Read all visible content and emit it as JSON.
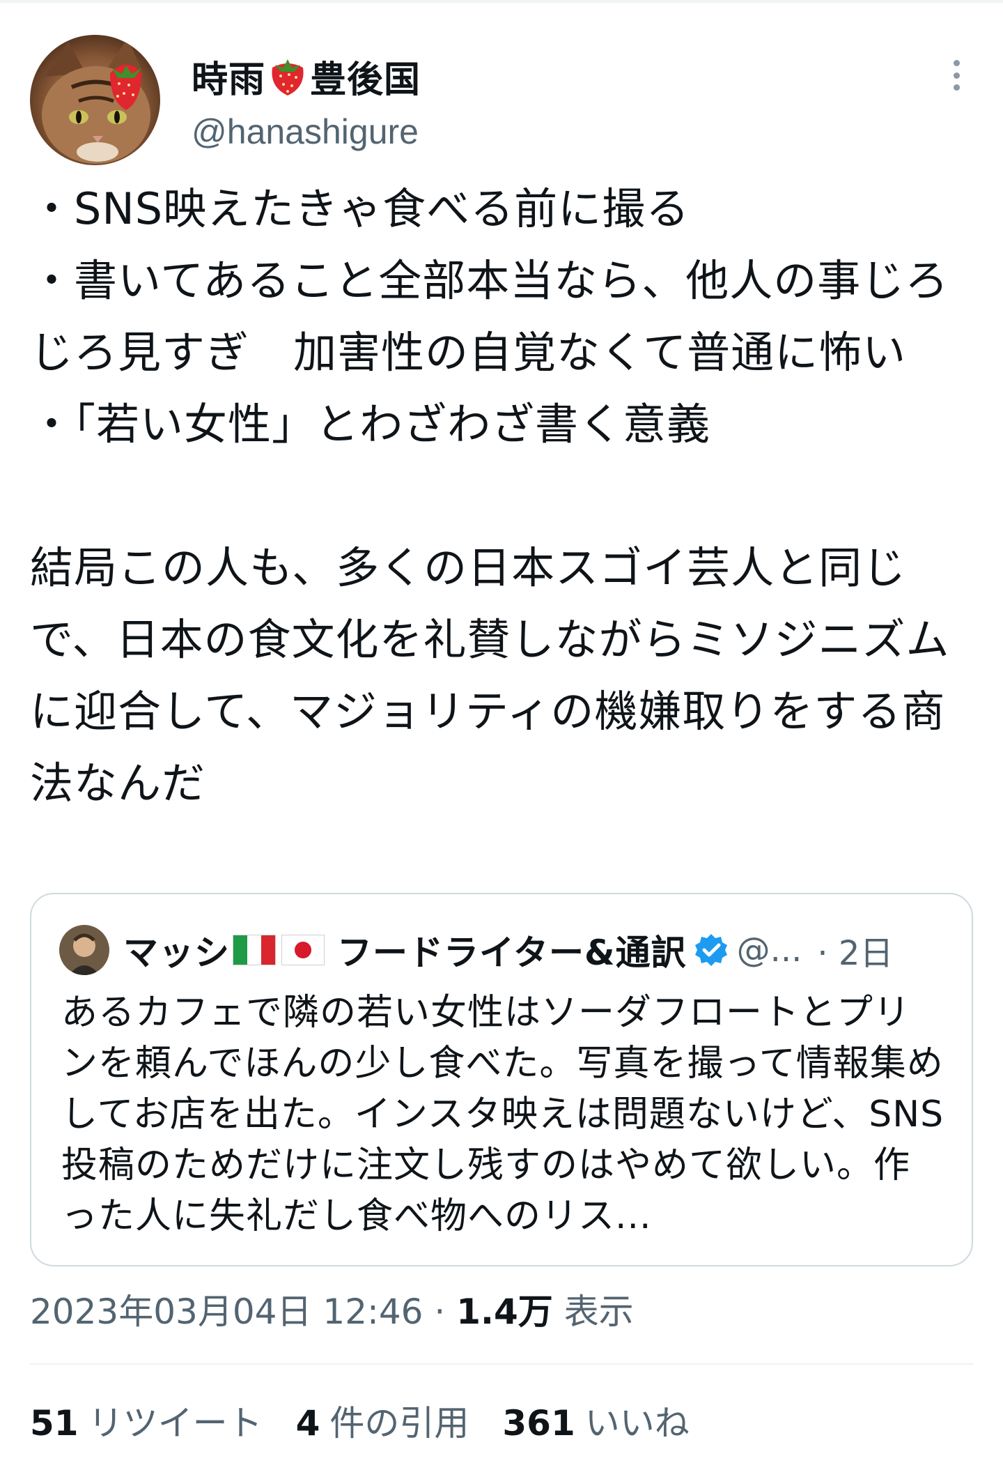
{
  "author": {
    "name_prefix": "時雨",
    "name_emoji": "strawberry-icon",
    "name_suffix": "豊後国",
    "handle": "@hanashigure"
  },
  "tweet": {
    "text": "・SNS映えたきゃ食べる前に撮る\n・書いてあること全部本当なら、他人の事じろじろ見すぎ　加害性の自覚なくて普通に怖い\n・「若い女性」とわざわざ書く意義\n\n結局この人も、多くの日本スゴイ芸人と同じで、日本の食文化を礼賛しながらミソジニズムに迎合して、マジョリティの機嫌取りをする商法なんだ"
  },
  "quote": {
    "name_prefix": "マッシ",
    "flags": [
      "italy-flag-icon",
      "japan-flag-icon"
    ],
    "name_suffix": "フードライター&通訳",
    "handle": "@...",
    "time": "· 2日",
    "text": "あるカフェで隣の若い女性はソーダフロートとプリンを頼んでほんの少し食べた。写真を撮って情報集めしてお店を出た。インスタ映えは問題ないけど、SNS投稿のためだけに注文し残すのはやめて欲しい。作った人に失礼だし食べ物へのリス..."
  },
  "meta": {
    "timestamp": "2023年03月04日 12:46",
    "separator": "·",
    "views_count": "1.4万",
    "views_label": "表示"
  },
  "stats": {
    "retweets_count": "51",
    "retweets_label": "リツイート",
    "quotes_count": "4",
    "quotes_label": "件の引用",
    "likes_count": "361",
    "likes_label": "いいね"
  },
  "colors": {
    "text": "#0f1419",
    "secondary": "#536471",
    "border": "#cfd9de",
    "verified": "#1d9bf0"
  }
}
